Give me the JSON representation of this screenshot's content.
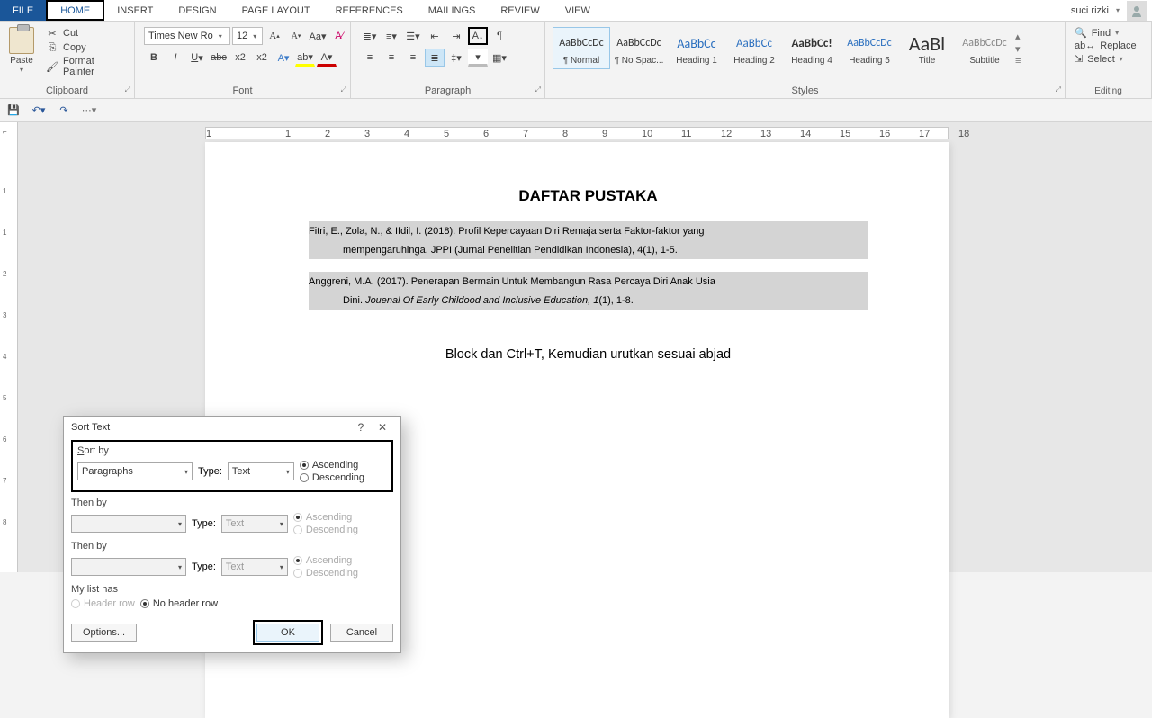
{
  "menubar": {
    "tabs": [
      "FILE",
      "HOME",
      "INSERT",
      "DESIGN",
      "PAGE LAYOUT",
      "REFERENCES",
      "MAILINGS",
      "REVIEW",
      "VIEW"
    ],
    "user": "suci rizki"
  },
  "ribbon": {
    "clipboard": {
      "paste": "Paste",
      "cut": "Cut",
      "copy": "Copy",
      "format_painter": "Format Painter",
      "label": "Clipboard"
    },
    "font": {
      "name": "Times New Ro",
      "size": "12",
      "label": "Font"
    },
    "paragraph": {
      "label": "Paragraph"
    },
    "styles": {
      "label": "Styles",
      "items": [
        {
          "preview": "AaBbCcDc",
          "name": "¶ Normal"
        },
        {
          "preview": "AaBbCcDc",
          "name": "¶ No Spac..."
        },
        {
          "preview": "AaBbCc",
          "name": "Heading 1"
        },
        {
          "preview": "AaBbCc",
          "name": "Heading 2"
        },
        {
          "preview": "AaBbCc!",
          "name": "Heading 4"
        },
        {
          "preview": "AaBbCcDc",
          "name": "Heading 5"
        },
        {
          "preview": "AaBl",
          "name": "Title"
        },
        {
          "preview": "AaBbCcDc",
          "name": "Subtitle"
        }
      ]
    },
    "editing": {
      "find": "Find",
      "replace": "Replace",
      "select": "Select",
      "label": "Editing"
    }
  },
  "document": {
    "title": "DAFTAR PUSTAKA",
    "p1a": "Fitri, E., Zola, N., & Ifdil, I. (2018). Profil Kepercayaan Diri Remaja serta Faktor-faktor yang",
    "p1b": "mempengaruhinga. JPPI (Jurnal Penelitian Pendidikan Indonesia), 4(1), 1-5.",
    "p2a": "Anggreni, M.A. (2017). Penerapan Bermain Untuk Membangun Rasa Percaya Diri Anak Usia",
    "p2b_pre": "Dini. ",
    "p2b_it": "Jouenal Of Early Childood and Inclusive Education, 1",
    "p2b_post": "(1), 1-8.",
    "instr": "Block dan Ctrl+T, Kemudian urutkan sesuai abjad"
  },
  "dialog": {
    "title": "Sort Text",
    "sort_by": "ort by",
    "then_by": "hen by",
    "then_by2": "Then by",
    "type": "Type:",
    "paragraphs": "Paragraphs",
    "text": "Text",
    "asc": "Ascending",
    "desc": "Descending",
    "my_list": "My list has",
    "header": "Header row",
    "noheader": "No header row",
    "options": "Options...",
    "ok": "OK",
    "cancel": "Cancel"
  },
  "ruler_marks": [
    "1",
    "",
    "1",
    "2",
    "3",
    "4",
    "5",
    "6",
    "7",
    "8",
    "9",
    "10",
    "11",
    "12",
    "13",
    "14",
    "15",
    "16",
    "17",
    "18"
  ]
}
